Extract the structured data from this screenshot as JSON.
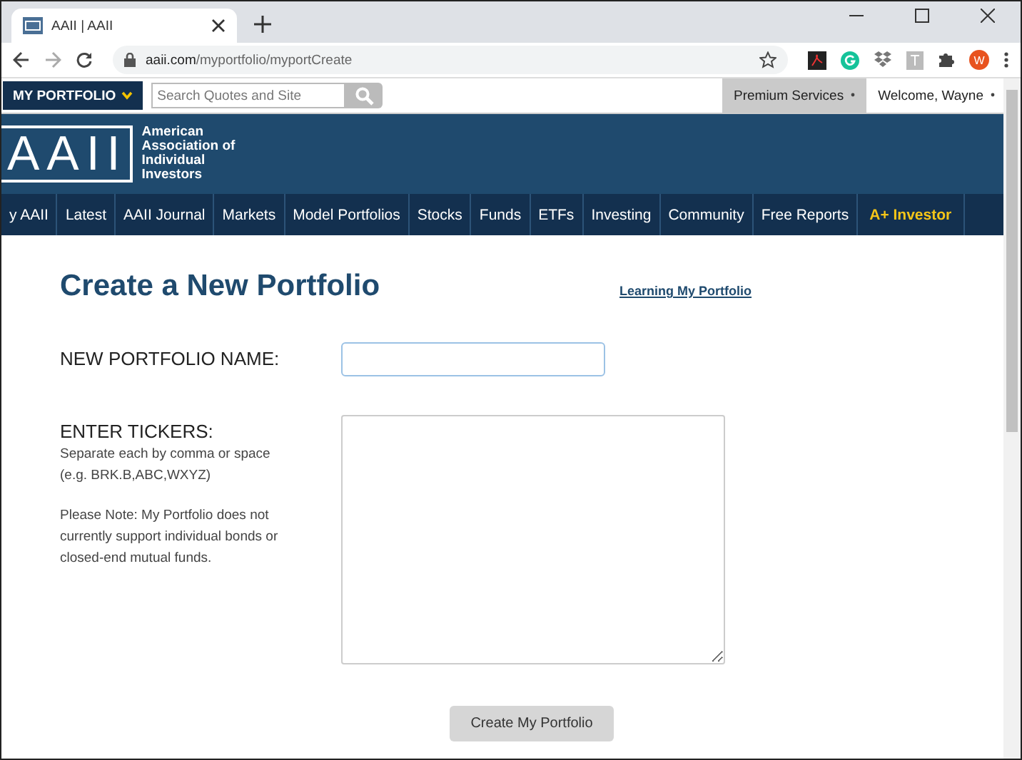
{
  "browser": {
    "tab_title": "AAII | AAII",
    "url_host": "aaii.com",
    "url_path": "/myportfolio/myportCreate",
    "avatar": "W"
  },
  "topbar": {
    "portfolio_menu": "MY PORTFOLIO",
    "search": {
      "placeholder": "Search Quotes and Site"
    },
    "premium": "Premium Services",
    "welcome": "Welcome, Wayne"
  },
  "logo": {
    "letters": "AAII",
    "name_lines": [
      "American",
      "Association of",
      "Individual",
      "Investors"
    ]
  },
  "nav": [
    {
      "label": "y AAII",
      "kind": "link"
    },
    {
      "label": "Latest",
      "kind": "link"
    },
    {
      "label": "AAII Journal",
      "kind": "link"
    },
    {
      "label": "Markets",
      "kind": "link"
    },
    {
      "label": "Model Portfolios",
      "kind": "link"
    },
    {
      "label": "Stocks",
      "kind": "link"
    },
    {
      "label": "Funds",
      "kind": "link"
    },
    {
      "label": "ETFs",
      "kind": "link"
    },
    {
      "label": "Investing",
      "kind": "link"
    },
    {
      "label": "Community",
      "kind": "link"
    },
    {
      "label": "Free Reports",
      "kind": "link"
    },
    {
      "label": "A+ Investor",
      "kind": "premium"
    }
  ],
  "form": {
    "title": "Create a New Portfolio",
    "help_link": "Learning My Portfolio",
    "name_label": "NEW PORTFOLIO NAME:",
    "tickers_label": "ENTER TICKERS:",
    "tickers_hint": [
      "Separate each by comma or space",
      "(e.g. BRK.B,ABC,WXYZ)"
    ],
    "note": "Please Note: My Portfolio does not currently support individual bonds or closed-end mutual funds.",
    "submit": "Create My Portfolio"
  }
}
